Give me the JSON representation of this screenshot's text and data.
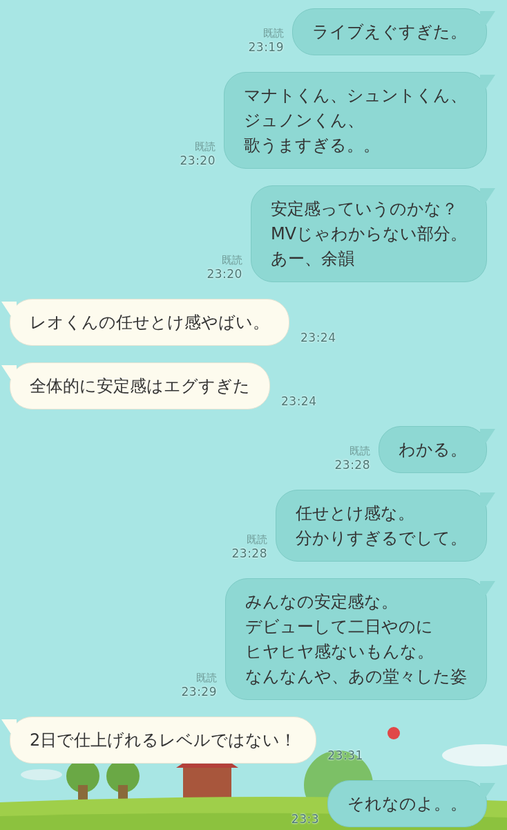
{
  "messages": [
    {
      "kind": "sent",
      "read": "既読",
      "time": "23:19",
      "lines": [
        "ライブえぐすぎた。"
      ]
    },
    {
      "kind": "sent",
      "read": "既読",
      "time": "23:20",
      "lines": [
        "マナトくん、シュントくん、",
        "ジュノンくん、",
        "歌うますぎる。。"
      ]
    },
    {
      "kind": "sent",
      "read": "既読",
      "time": "23:20",
      "lines": [
        "安定感っていうのかな？",
        "MVじゃわからない部分。",
        "あー、余韻"
      ]
    },
    {
      "kind": "received",
      "time": "23:24",
      "lines": [
        "レオくんの任せとけ感やばい。"
      ]
    },
    {
      "kind": "received",
      "time": "23:24",
      "lines": [
        "全体的に安定感はエグすぎた"
      ]
    },
    {
      "kind": "sent",
      "read": "既読",
      "time": "23:28",
      "lines": [
        "わかる。"
      ]
    },
    {
      "kind": "sent",
      "read": "既読",
      "time": "23:28",
      "lines": [
        "任せとけ感な。",
        "分かりすぎるでして。"
      ]
    },
    {
      "kind": "sent",
      "read": "既読",
      "time": "23:29",
      "lines": [
        "みんなの安定感な。",
        "デビューして二日やのに",
        "ヒヤヒヤ感ないもんな。",
        "なんなんや、あの堂々した姿"
      ]
    },
    {
      "kind": "received",
      "time": "23:31",
      "lines": [
        "2日で仕上げれるレベルではない！"
      ]
    },
    {
      "kind": "sent",
      "time": "23:3",
      "lines": [
        "それなのよ。。"
      ]
    }
  ]
}
